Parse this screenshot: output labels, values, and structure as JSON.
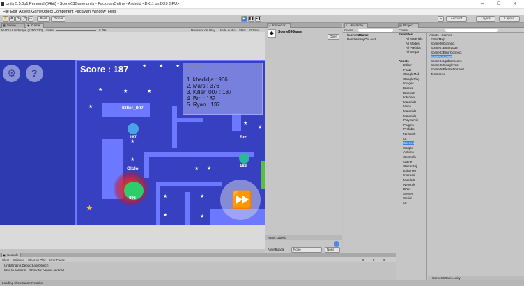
{
  "window": {
    "title": "Unity 5.5.0p1 Personal (64bit) - Scene03Game.unity - PackmanOnline - Android <DX11 on DX9 GPU>",
    "min": "–",
    "max": "☐",
    "close": "✕"
  },
  "menu": [
    "File",
    "Edit",
    "Assets",
    "GameObject",
    "Component",
    "PackMan",
    "Window",
    "Help"
  ],
  "toolbar": {
    "pivot": "Pivot",
    "global": "Global",
    "account": "Account",
    "layers": "Layers",
    "layout": "Layout",
    "cloud": "☁"
  },
  "game_view": {
    "tabs": [
      "Scene",
      "Game"
    ],
    "resolution": "NVIDIA Landscape (1280x720)",
    "scale_label": "Scale",
    "scale_value": "0.78x",
    "options": [
      "Maximize On Play",
      "Mute Audio",
      "Stats",
      "Gizmos"
    ],
    "score_text": "Score : 187",
    "leaderboard": [
      "1. khadidja : 966",
      "2. Mars : 376",
      "3. Killer_007 : 187",
      "4. Bro : 182",
      "5. Ryan : 137"
    ],
    "players": [
      {
        "name": "Killer_007",
        "score": "187"
      },
      {
        "name": "Bro",
        "score": "182"
      },
      {
        "name": "Ololo",
        "score": "896"
      }
    ]
  },
  "inspector": {
    "tab": "Inspector",
    "object_name": "Scene03Game",
    "open_btn": "Open",
    "asset_labels": "Asset Labels",
    "assetbundle_label": "AssetBundle",
    "none1": "None",
    "none2": "None"
  },
  "hierarchy": {
    "tab": "Hierarchy",
    "create": "Create",
    "items": [
      "Scene03Game",
      "DontDestroyOnLoad"
    ]
  },
  "project": {
    "tab": "Project",
    "create": "Create",
    "breadcrumb": "Assets › Scenes",
    "favorites_label": "Favorites",
    "favorites": [
      "All Materials",
      "All Models",
      "All Prefabs",
      "All Scripts"
    ],
    "assets_label": "Assets",
    "folders": [
      "Editor",
      "Fonts",
      "GoogleMob",
      "GooglePlay",
      "Images",
      "Blocks",
      "Blocks2",
      "Interface",
      "Materials",
      "Icons",
      "Materials",
      "Materials",
      "PlayServic",
      "Plugins",
      "Prefabs",
      "NetWork",
      "UI",
      "Scenes",
      "Scripts",
      "Actions",
      "Controlls",
      "Game",
      "GameObj",
      "EditorMo",
      "Instructi",
      "MobileC",
      "Network",
      "DNet",
      "Server",
      "Serial",
      "UI"
    ],
    "scenes": [
      "EditorMap",
      "Scene00Connect",
      "Scene01EnterLogin",
      "Scene02ErrorConnect",
      "Scene03Game",
      "Scene04UpdateScene",
      "Scene05GoogleTest",
      "Scene06PleaseTryLater",
      "TestScene"
    ],
    "bottom_file": "Scene03Game.unity"
  },
  "console": {
    "tab": "Console",
    "buttons": [
      "Clear",
      "Collapse",
      "Clear on Play",
      "Error Pause"
    ],
    "lines": [
      "UnityEngine.Debug:Log(Object)",
      "Wait to server s... Show for banner and call..."
    ],
    "counts": [
      "0",
      "0",
      "0"
    ]
  },
  "status": "Loading showBannerRelative"
}
